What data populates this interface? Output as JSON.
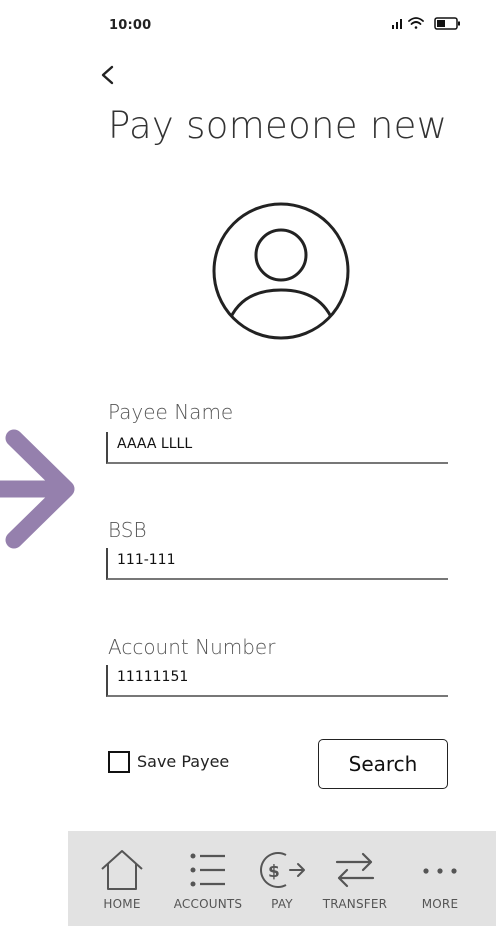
{
  "status_bar": {
    "time": "10:00"
  },
  "page": {
    "title": "Pay someone new"
  },
  "form": {
    "payee_name": {
      "label": "Payee Name",
      "value": "AAAA LLLL"
    },
    "bsb": {
      "label": "BSB",
      "value": "111-111"
    },
    "account_number": {
      "label": "Account Number",
      "value": "11111151"
    },
    "save_payee": {
      "label": "Save Payee",
      "checked": false
    },
    "search_label": "Search"
  },
  "nav": {
    "items": [
      {
        "label": "HOME",
        "icon": "home-icon"
      },
      {
        "label": "ACCOUNTS",
        "icon": "list-icon"
      },
      {
        "label": "PAY",
        "icon": "pay-icon"
      },
      {
        "label": "TRANSFER",
        "icon": "transfer-icon"
      },
      {
        "label": "MORE",
        "icon": "more-icon"
      }
    ]
  },
  "colors": {
    "annotation_arrow": "#9580ad",
    "nav_background": "#e2e2e2"
  }
}
